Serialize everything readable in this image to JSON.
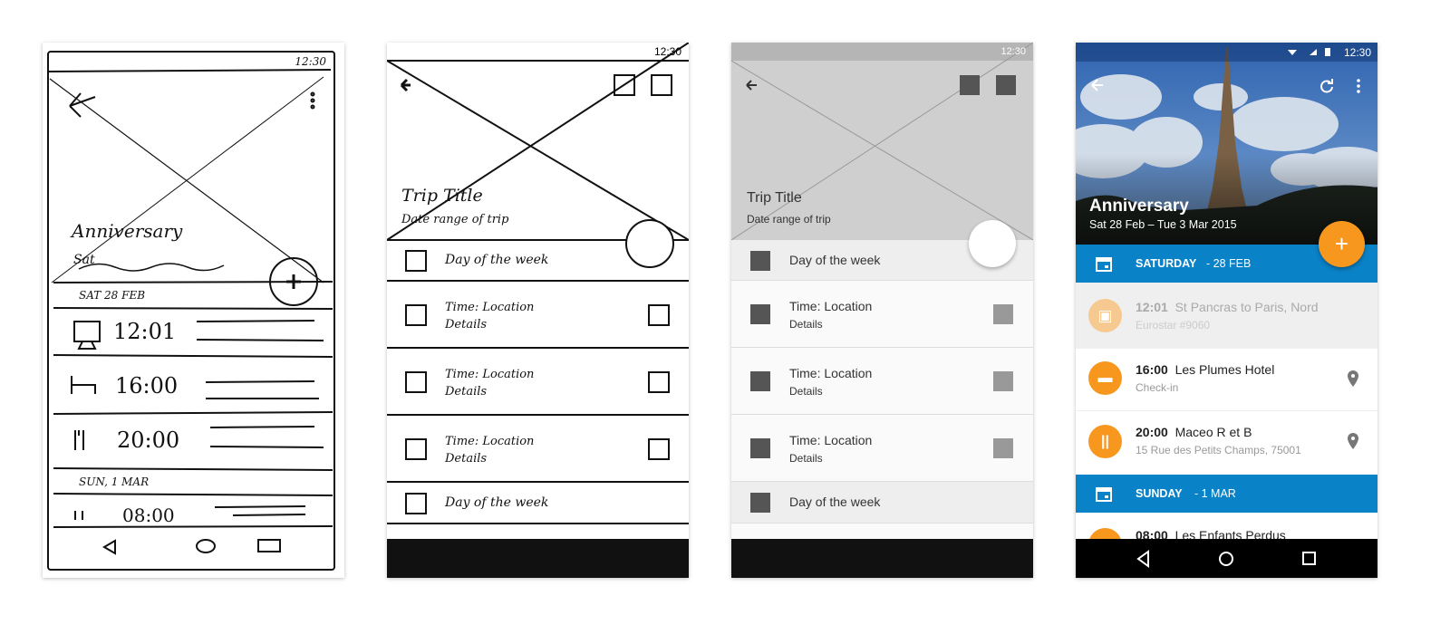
{
  "sketch": {
    "status_time": "12:30",
    "title": "Anniversary",
    "subtitle": "Sat",
    "day1": "SAT 28 FEB",
    "events": [
      {
        "time": "12:01",
        "icon": "train-icon"
      },
      {
        "time": "16:00",
        "icon": "bed-icon"
      },
      {
        "time": "20:00",
        "icon": "fork-knife-icon"
      }
    ],
    "day2": "SUN, 1 MAR",
    "event4_time": "08:00"
  },
  "wireframe": {
    "status_time": "12:30",
    "title": "Trip Title",
    "subtitle": "Date range of trip",
    "day_label": "Day of the week",
    "item_title": "Time: Location",
    "item_details": "Details"
  },
  "grey_wireframe": {
    "status_time": "12:30",
    "title": "Trip Title",
    "subtitle": "Date range of trip",
    "day_label": "Day of the week",
    "item_title": "Time: Location",
    "item_details": "Details"
  },
  "final": {
    "status_time": "12:30",
    "title": "Anniversary",
    "date_range": "Sat 28 Feb – Tue 3 Mar 2015",
    "accent": "#0a82c8",
    "fab_color": "#f7971e",
    "day1": {
      "name": "SATURDAY",
      "date": "- 28 FEB"
    },
    "day2": {
      "name": "SUNDAY",
      "date": "- 1 MAR"
    },
    "events": [
      {
        "time": "12:01",
        "title": "St Pancras to Paris, Nord",
        "sub": "Eurostar #9060",
        "icon": "train-icon",
        "past": true
      },
      {
        "time": "16:00",
        "title": "Les Plumes Hotel",
        "sub": "Check-in",
        "icon": "bed-icon",
        "past": false
      },
      {
        "time": "20:00",
        "title": "Maceo R et B",
        "sub": "15 Rue des Petits Champs, 75001",
        "icon": "fork-knife-icon",
        "past": false
      }
    ],
    "event4": {
      "time": "08:00",
      "title": "Les Enfants Perdus"
    }
  }
}
